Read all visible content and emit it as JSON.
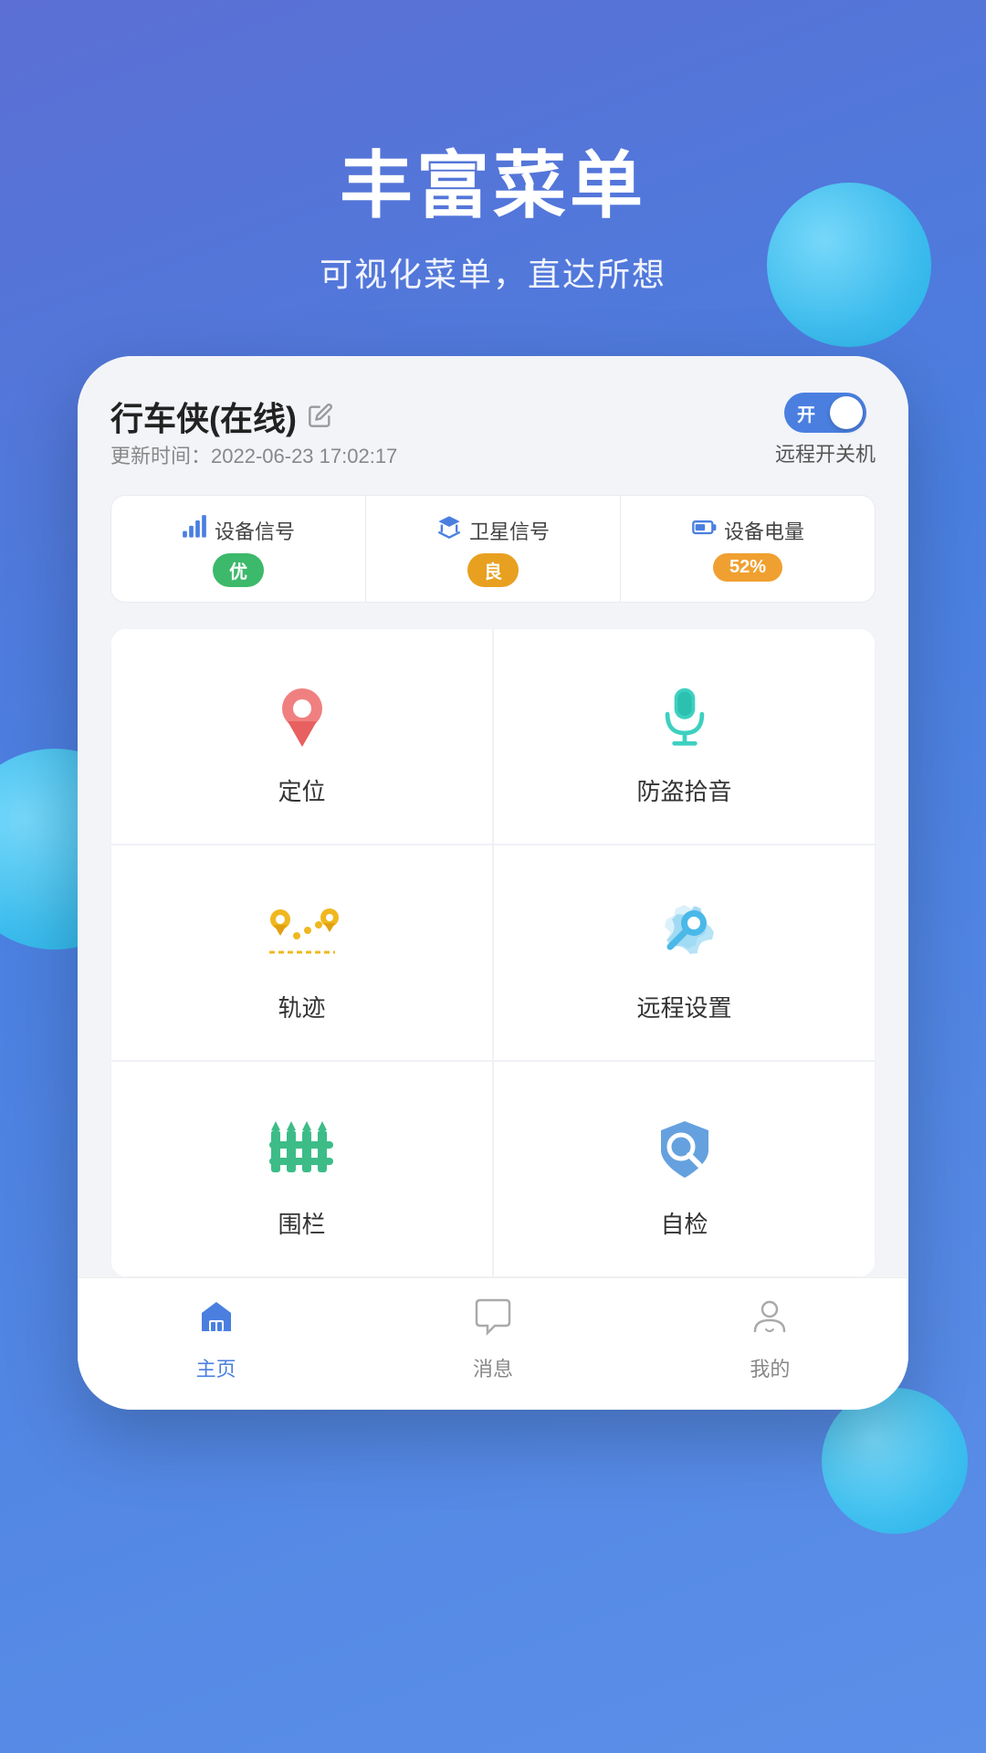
{
  "header": {
    "title": "丰富菜单",
    "subtitle": "可视化菜单，直达所想"
  },
  "device": {
    "name": "行车侠(在线)",
    "update_label": "更新时间：2022-06-23 17:02:17",
    "toggle_on": "开",
    "remote_label": "远程开关机",
    "signals": [
      {
        "icon": "📶",
        "label": "设备信号",
        "badge": "优",
        "badge_type": "green"
      },
      {
        "icon": "🛰",
        "label": "卫星信号",
        "badge": "良",
        "badge_type": "yellow"
      },
      {
        "icon": "🔋",
        "label": "设备电量",
        "badge": "52%",
        "badge_type": "orange"
      }
    ],
    "menu_items": [
      {
        "id": "location",
        "label": "定位"
      },
      {
        "id": "mic",
        "label": "防盗拾音"
      },
      {
        "id": "track",
        "label": "轨迹"
      },
      {
        "id": "settings",
        "label": "远程设置"
      },
      {
        "id": "fence",
        "label": "围栏"
      },
      {
        "id": "inspect",
        "label": "自检"
      }
    ]
  },
  "nav": {
    "items": [
      {
        "id": "home",
        "label": "主页",
        "active": true
      },
      {
        "id": "message",
        "label": "消息",
        "active": false
      },
      {
        "id": "profile",
        "label": "我的",
        "active": false
      }
    ]
  }
}
